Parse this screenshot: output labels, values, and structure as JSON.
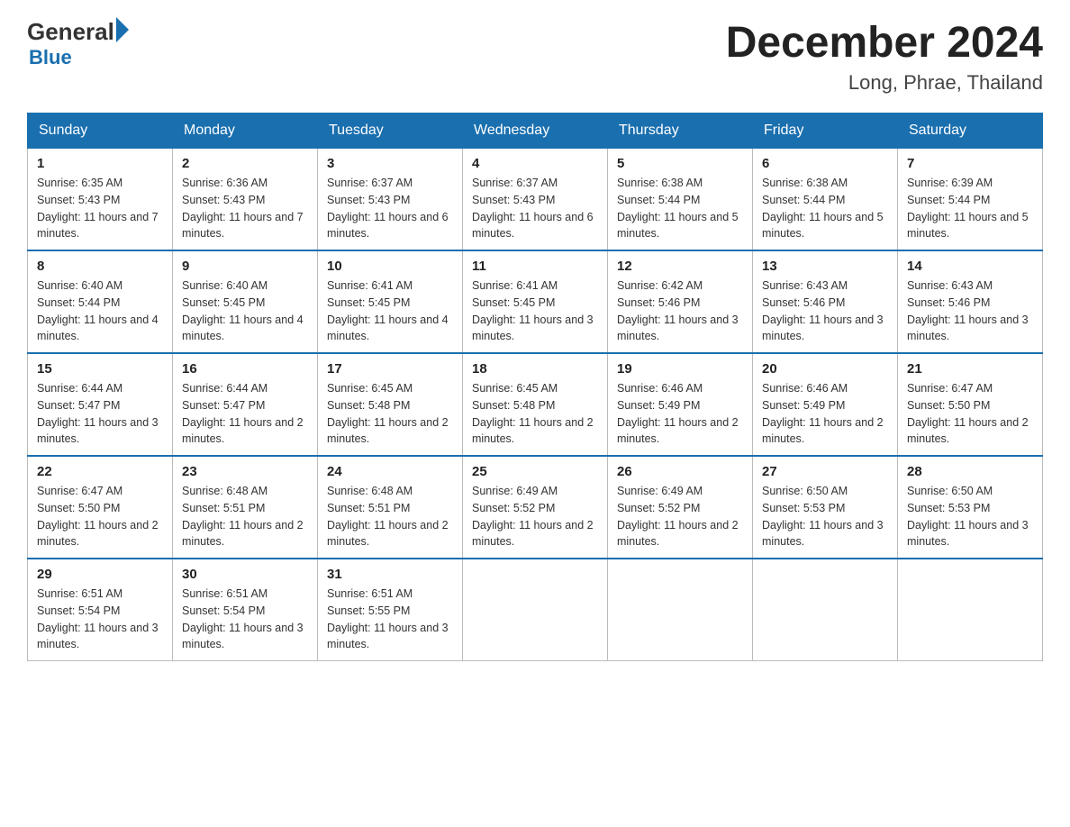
{
  "header": {
    "logo_general": "General",
    "logo_blue": "Blue",
    "month_title": "December 2024",
    "location": "Long, Phrae, Thailand"
  },
  "weekdays": [
    "Sunday",
    "Monday",
    "Tuesday",
    "Wednesday",
    "Thursday",
    "Friday",
    "Saturday"
  ],
  "weeks": [
    [
      {
        "day": "1",
        "sunrise": "6:35 AM",
        "sunset": "5:43 PM",
        "daylight": "11 hours and 7 minutes."
      },
      {
        "day": "2",
        "sunrise": "6:36 AM",
        "sunset": "5:43 PM",
        "daylight": "11 hours and 7 minutes."
      },
      {
        "day": "3",
        "sunrise": "6:37 AM",
        "sunset": "5:43 PM",
        "daylight": "11 hours and 6 minutes."
      },
      {
        "day": "4",
        "sunrise": "6:37 AM",
        "sunset": "5:43 PM",
        "daylight": "11 hours and 6 minutes."
      },
      {
        "day": "5",
        "sunrise": "6:38 AM",
        "sunset": "5:44 PM",
        "daylight": "11 hours and 5 minutes."
      },
      {
        "day": "6",
        "sunrise": "6:38 AM",
        "sunset": "5:44 PM",
        "daylight": "11 hours and 5 minutes."
      },
      {
        "day": "7",
        "sunrise": "6:39 AM",
        "sunset": "5:44 PM",
        "daylight": "11 hours and 5 minutes."
      }
    ],
    [
      {
        "day": "8",
        "sunrise": "6:40 AM",
        "sunset": "5:44 PM",
        "daylight": "11 hours and 4 minutes."
      },
      {
        "day": "9",
        "sunrise": "6:40 AM",
        "sunset": "5:45 PM",
        "daylight": "11 hours and 4 minutes."
      },
      {
        "day": "10",
        "sunrise": "6:41 AM",
        "sunset": "5:45 PM",
        "daylight": "11 hours and 4 minutes."
      },
      {
        "day": "11",
        "sunrise": "6:41 AM",
        "sunset": "5:45 PM",
        "daylight": "11 hours and 3 minutes."
      },
      {
        "day": "12",
        "sunrise": "6:42 AM",
        "sunset": "5:46 PM",
        "daylight": "11 hours and 3 minutes."
      },
      {
        "day": "13",
        "sunrise": "6:43 AM",
        "sunset": "5:46 PM",
        "daylight": "11 hours and 3 minutes."
      },
      {
        "day": "14",
        "sunrise": "6:43 AM",
        "sunset": "5:46 PM",
        "daylight": "11 hours and 3 minutes."
      }
    ],
    [
      {
        "day": "15",
        "sunrise": "6:44 AM",
        "sunset": "5:47 PM",
        "daylight": "11 hours and 3 minutes."
      },
      {
        "day": "16",
        "sunrise": "6:44 AM",
        "sunset": "5:47 PM",
        "daylight": "11 hours and 2 minutes."
      },
      {
        "day": "17",
        "sunrise": "6:45 AM",
        "sunset": "5:48 PM",
        "daylight": "11 hours and 2 minutes."
      },
      {
        "day": "18",
        "sunrise": "6:45 AM",
        "sunset": "5:48 PM",
        "daylight": "11 hours and 2 minutes."
      },
      {
        "day": "19",
        "sunrise": "6:46 AM",
        "sunset": "5:49 PM",
        "daylight": "11 hours and 2 minutes."
      },
      {
        "day": "20",
        "sunrise": "6:46 AM",
        "sunset": "5:49 PM",
        "daylight": "11 hours and 2 minutes."
      },
      {
        "day": "21",
        "sunrise": "6:47 AM",
        "sunset": "5:50 PM",
        "daylight": "11 hours and 2 minutes."
      }
    ],
    [
      {
        "day": "22",
        "sunrise": "6:47 AM",
        "sunset": "5:50 PM",
        "daylight": "11 hours and 2 minutes."
      },
      {
        "day": "23",
        "sunrise": "6:48 AM",
        "sunset": "5:51 PM",
        "daylight": "11 hours and 2 minutes."
      },
      {
        "day": "24",
        "sunrise": "6:48 AM",
        "sunset": "5:51 PM",
        "daylight": "11 hours and 2 minutes."
      },
      {
        "day": "25",
        "sunrise": "6:49 AM",
        "sunset": "5:52 PM",
        "daylight": "11 hours and 2 minutes."
      },
      {
        "day": "26",
        "sunrise": "6:49 AM",
        "sunset": "5:52 PM",
        "daylight": "11 hours and 2 minutes."
      },
      {
        "day": "27",
        "sunrise": "6:50 AM",
        "sunset": "5:53 PM",
        "daylight": "11 hours and 3 minutes."
      },
      {
        "day": "28",
        "sunrise": "6:50 AM",
        "sunset": "5:53 PM",
        "daylight": "11 hours and 3 minutes."
      }
    ],
    [
      {
        "day": "29",
        "sunrise": "6:51 AM",
        "sunset": "5:54 PM",
        "daylight": "11 hours and 3 minutes."
      },
      {
        "day": "30",
        "sunrise": "6:51 AM",
        "sunset": "5:54 PM",
        "daylight": "11 hours and 3 minutes."
      },
      {
        "day": "31",
        "sunrise": "6:51 AM",
        "sunset": "5:55 PM",
        "daylight": "11 hours and 3 minutes."
      },
      null,
      null,
      null,
      null
    ]
  ]
}
